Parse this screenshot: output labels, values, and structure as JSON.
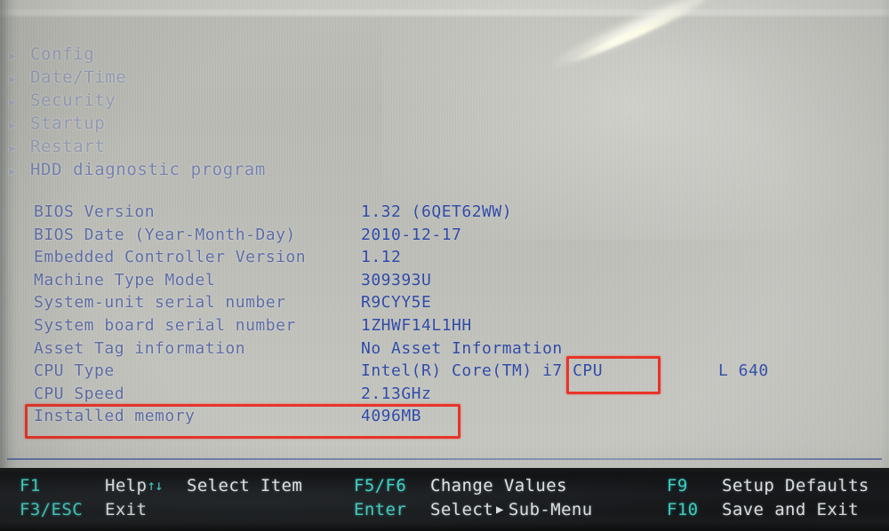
{
  "screen": {
    "title": "ThinkPad BIOS Setup Utility - Main Information",
    "background_color": "#b7b8b2",
    "text_color": "#2f49a6",
    "menu_text_color": "#8e96b4",
    "annotation_color": "#e8342a",
    "footer_background": "#111315",
    "footer_key_color": "#3fd6c9",
    "footer_label_color": "#e9ecef"
  },
  "menu": {
    "items": [
      {
        "caret": "▶",
        "label": "Config"
      },
      {
        "caret": "▶",
        "label": "Date/Time"
      },
      {
        "caret": "▶",
        "label": "Security"
      },
      {
        "caret": "▶",
        "label": "Startup"
      },
      {
        "caret": "▶",
        "label": "Restart"
      },
      {
        "caret": "▶",
        "label": "HDD diagnostic program"
      }
    ]
  },
  "info": {
    "rows": [
      {
        "label": "BIOS Version",
        "value": "1.32   (6QET62WW)",
        "extra": ""
      },
      {
        "label": "BIOS Date (Year-Month-Day)",
        "value": "2010-12-17",
        "extra": ""
      },
      {
        "label": "Embedded Controller Version",
        "value": "1.12",
        "extra": ""
      },
      {
        "label": "Machine Type Model",
        "value": "309393U",
        "extra": ""
      },
      {
        "label": "System-unit serial number",
        "value": "R9CYY5E",
        "extra": ""
      },
      {
        "label": "System board serial number",
        "value": "1ZHWF14L1HH",
        "extra": ""
      },
      {
        "label": "Asset Tag information",
        "value": "No Asset Information",
        "extra": ""
      },
      {
        "label": "CPU Type",
        "value": "Intel(R) Core(TM) i7 CPU",
        "extra": "L 640"
      },
      {
        "label": "CPU Speed",
        "value": "2.13GHz",
        "extra": ""
      },
      {
        "label": "Installed memory",
        "value": "4096MB",
        "extra": ""
      }
    ]
  },
  "annotations": [
    {
      "name": "cpu-type-highlight",
      "target": "i7 CPU"
    },
    {
      "name": "installed-memory-highlight",
      "target": "Installed memory  4096MB"
    }
  ],
  "footer": {
    "entries": [
      {
        "key": "F1",
        "arrows": "",
        "label": "Help",
        "caret": ""
      },
      {
        "key": "",
        "arrows": "↑↓",
        "label": "Select Item",
        "caret": ""
      },
      {
        "key": "F5/F6",
        "arrows": "",
        "label": "Change Values",
        "caret": ""
      },
      {
        "key": "F9",
        "arrows": "",
        "label": "Setup Defaults",
        "caret": ""
      },
      {
        "key": "F3/ESC",
        "arrows": "",
        "label": "Exit",
        "caret": ""
      },
      {
        "key": "Enter",
        "arrows": "",
        "label": "Select",
        "caret": "▶",
        "label2": "Sub-Menu"
      },
      {
        "key": "F10",
        "arrows": "",
        "label": "Save and Exit",
        "caret": ""
      }
    ],
    "f1_key": "F1",
    "f1_label": "Help",
    "select_item_arrows": "↑↓",
    "select_item_label": "Select Item",
    "f5f6_key": "F5/F6",
    "f5f6_label": "Change Values",
    "f9_key": "F9",
    "f9_label": "Setup Defaults",
    "f3esc_key": "F3/ESC",
    "f3esc_label": "Exit",
    "enter_key": "Enter",
    "enter_label": "Select",
    "enter_caret": "▶",
    "enter_label2": "Sub-Menu",
    "f10_key": "F10",
    "f10_label": "Save and Exit"
  }
}
